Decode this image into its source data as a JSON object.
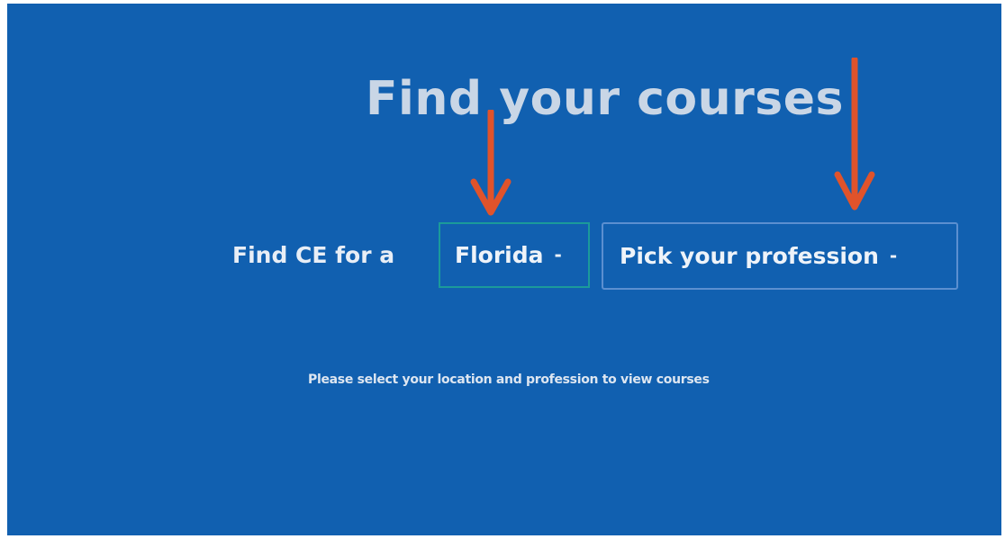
{
  "heading": {
    "title": "Find your courses"
  },
  "finder": {
    "prefix_label": "Find CE for a",
    "state_dropdown": {
      "selected": "Florida",
      "caret": "-"
    },
    "profession_dropdown": {
      "selected": "Pick your profession",
      "caret": "-"
    }
  },
  "helper": {
    "text": "Please select your location and profession to view courses"
  },
  "colors": {
    "background": "#1160b0",
    "annotation_arrow": "#e0532b",
    "state_border": "#1b9a9a",
    "profession_border": "#5b8fd0"
  },
  "annotations": {
    "arrow_icons": [
      "down-arrow-icon",
      "down-arrow-icon"
    ]
  }
}
